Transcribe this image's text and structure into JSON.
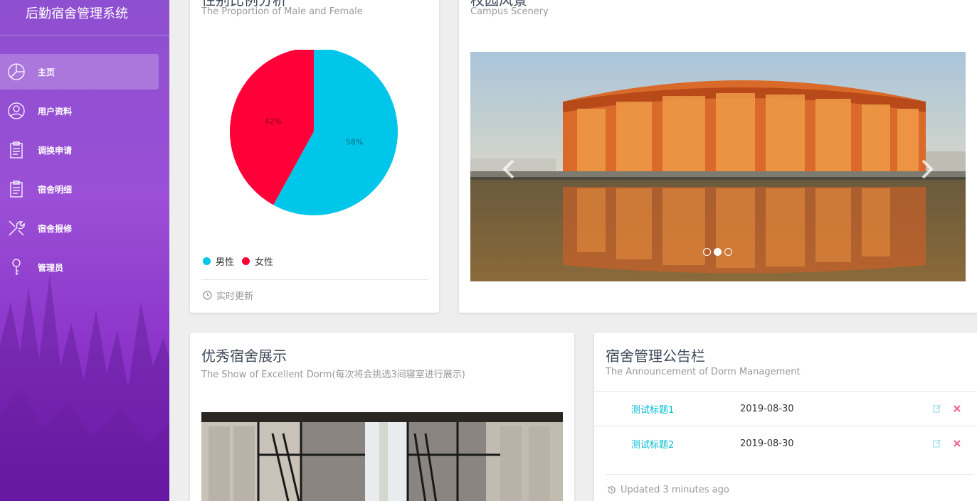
{
  "sidebar": {
    "brand": "后勤宿舍管理系统",
    "items": [
      {
        "label": "主页",
        "icon": "dashboard-icon"
      },
      {
        "label": "用户资料",
        "icon": "user-icon"
      },
      {
        "label": "调换申请",
        "icon": "clipboard-icon"
      },
      {
        "label": "宿舍明细",
        "icon": "clipboard-icon"
      },
      {
        "label": "宿舍报修",
        "icon": "wrench-icon"
      },
      {
        "label": "管理员",
        "icon": "key-icon"
      }
    ]
  },
  "gender_card": {
    "title": "性别比例分析",
    "subtitle": "The Proportion of Male and Female",
    "footer": "实时更新",
    "chart_data": {
      "type": "pie",
      "categories": [
        "男性",
        "女性"
      ],
      "values": [
        58,
        42
      ],
      "labels": [
        "58%",
        "42%"
      ],
      "colors": [
        "#00c6ea",
        "#ff0039"
      ],
      "legend_position": "bottom-left"
    }
  },
  "scenery_card": {
    "title": "校园风景",
    "subtitle": "Campus Scenery",
    "active_slide": 1,
    "slide_count": 3
  },
  "dorm_card": {
    "title": "优秀宿舍展示",
    "subtitle": "The Show of Excellent Dorm(每次将会挑选3间寝室进行展示)"
  },
  "notice_card": {
    "title": "宿舍管理公告栏",
    "subtitle": "The Announcement of Dorm Management",
    "rows": [
      {
        "title": "测试标题1",
        "date": "2019-08-30"
      },
      {
        "title": "测试标题2",
        "date": "2019-08-30"
      }
    ],
    "footer": "Updated 3 minutes ago"
  },
  "colors": {
    "accent": "#00bcd4",
    "danger": "#f44336",
    "sidebar_top": "#8e4fd0",
    "sidebar_bottom": "#7a1ebd"
  }
}
